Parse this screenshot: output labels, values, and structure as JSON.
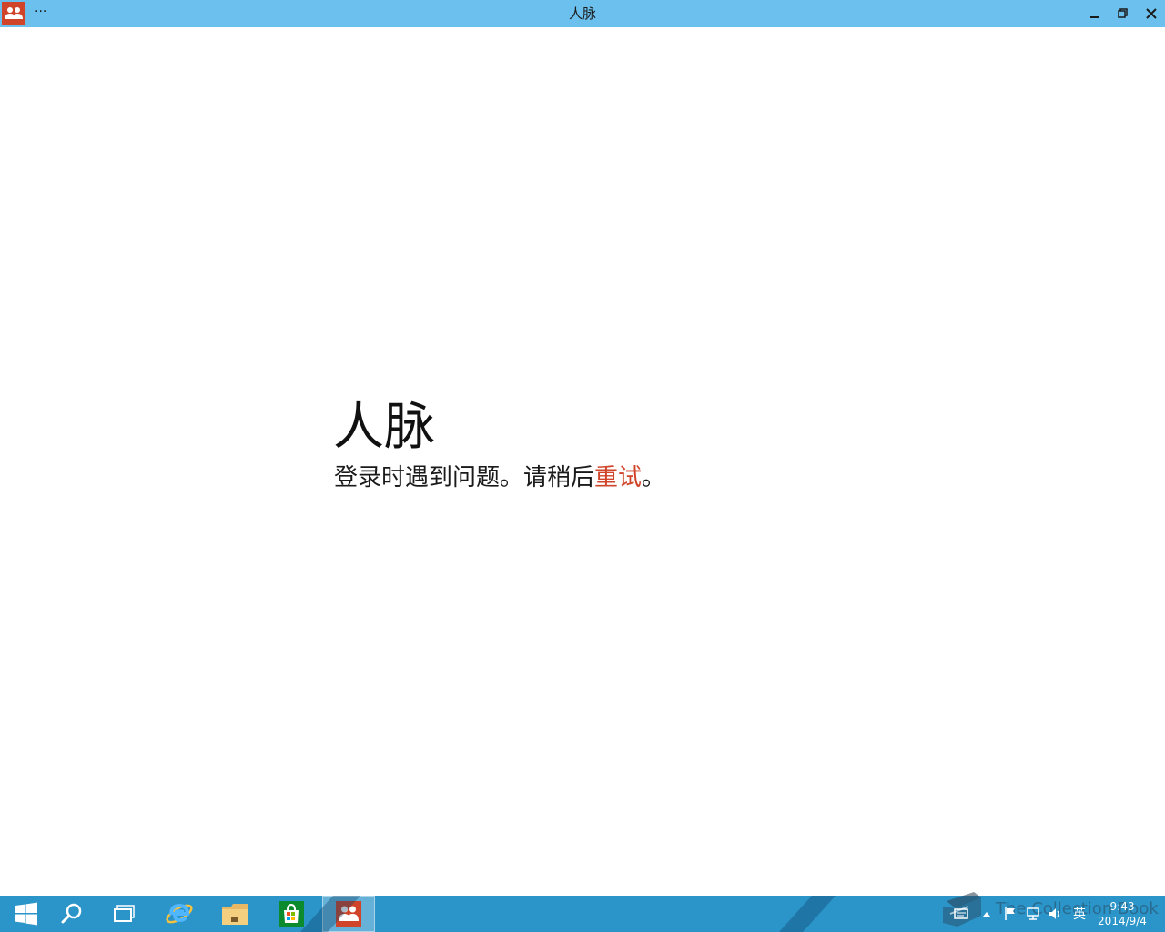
{
  "window": {
    "title": "人脉",
    "menu_label": "···"
  },
  "main": {
    "heading": "人脉",
    "error_message": "登录时遇到问题。请稍后",
    "retry_label": "重试",
    "error_suffix": "。"
  },
  "taskbar": {
    "buttons": [
      {
        "name": "start",
        "icon": "windows-logo-icon"
      },
      {
        "name": "search",
        "icon": "search-icon"
      },
      {
        "name": "task-view",
        "icon": "task-view-icon"
      },
      {
        "name": "internet-explorer",
        "icon": "ie-icon"
      },
      {
        "name": "file-explorer",
        "icon": "folder-icon"
      },
      {
        "name": "store",
        "icon": "store-icon"
      },
      {
        "name": "people",
        "icon": "people-icon",
        "active": true
      }
    ],
    "tray": {
      "input_method": "英",
      "time": "9:43",
      "date": "2014/9/4"
    },
    "watermark": "The Collection Book"
  },
  "colors": {
    "titlebar": "#6bc0ee",
    "accent": "#d0452a",
    "taskbar": "#2b94c8"
  }
}
